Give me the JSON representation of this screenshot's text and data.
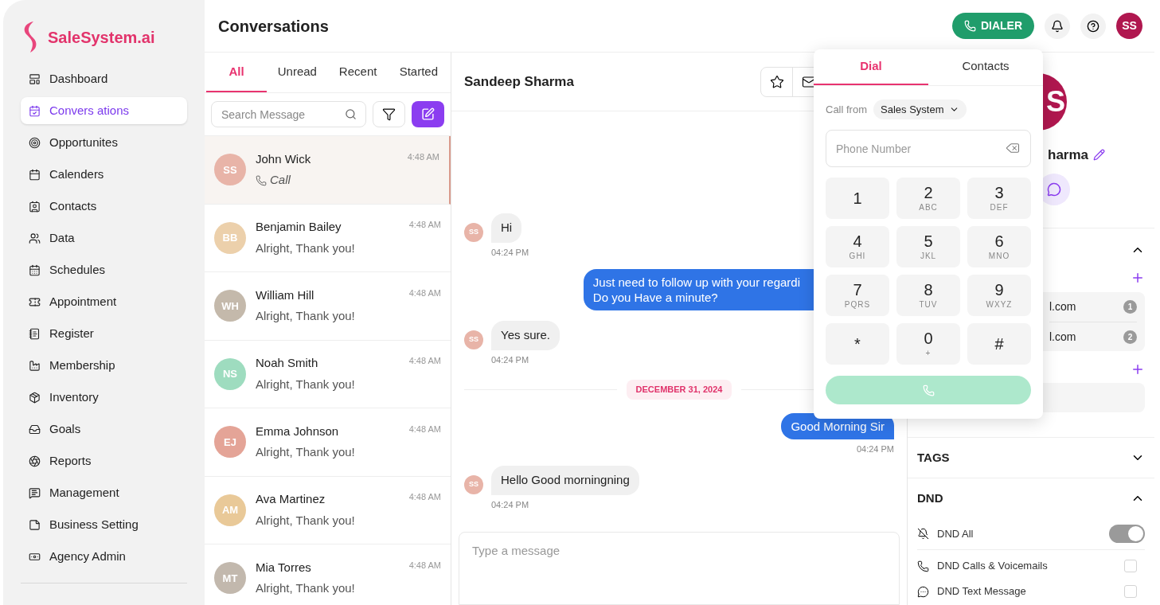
{
  "sidebar": {
    "logo": "SaleSystem.ai",
    "items": [
      {
        "label": "Dashboard",
        "selected": false
      },
      {
        "label": "Convers ations",
        "selected": true
      },
      {
        "label": "Opportunites",
        "selected": false
      },
      {
        "label": "Calenders",
        "selected": false
      },
      {
        "label": "Contacts",
        "selected": false
      },
      {
        "label": "Data",
        "selected": false
      },
      {
        "label": "Schedules",
        "selected": false
      },
      {
        "label": "Appointment",
        "selected": false
      },
      {
        "label": "Register",
        "selected": false
      },
      {
        "label": "Membership",
        "selected": false
      },
      {
        "label": "Inventory",
        "selected": false
      },
      {
        "label": "Goals",
        "selected": false
      },
      {
        "label": "Reports",
        "selected": false
      },
      {
        "label": "Management",
        "selected": false
      },
      {
        "label": "Business Setting",
        "selected": false
      },
      {
        "label": "Agency Admin",
        "selected": false
      }
    ]
  },
  "header": {
    "title": "Conversations",
    "dialer_button": "DIALER",
    "user_initials": "SS"
  },
  "conversation_list": {
    "tabs": [
      {
        "label": "All",
        "selected": true
      },
      {
        "label": "Unread",
        "selected": false
      },
      {
        "label": "Recent",
        "selected": false
      },
      {
        "label": "Started",
        "selected": false
      }
    ],
    "search": {
      "placeholder": "Search Message"
    },
    "items": [
      {
        "initials": "SS",
        "color": "#e8b4a8",
        "name": "John Wick",
        "time": "4:48 AM",
        "preview": "Call",
        "kind": "call",
        "selected": true
      },
      {
        "initials": "BB",
        "color": "#ecd0ab",
        "name": "Benjamin Bailey",
        "time": "4:48 AM",
        "preview": "Alright, Thank you!",
        "kind": "text",
        "selected": false
      },
      {
        "initials": "WH",
        "color": "#c4b9ab",
        "name": "William Hill",
        "time": "4:48 AM",
        "preview": "Alright, Thank you!",
        "kind": "text",
        "selected": false
      },
      {
        "initials": "NS",
        "color": "#9edcbf",
        "name": "Noah Smith",
        "time": "4:48 AM",
        "preview": "Alright, Thank you!",
        "kind": "text",
        "selected": false
      },
      {
        "initials": "EJ",
        "color": "#e4a497",
        "name": "Emma Johnson",
        "time": "4:48 AM",
        "preview": "Alright, Thank you!",
        "kind": "text",
        "selected": false
      },
      {
        "initials": "AM",
        "color": "#e9c998",
        "name": "Ava Martinez",
        "time": "4:48 AM",
        "preview": "Alright, Thank you!",
        "kind": "text",
        "selected": false
      },
      {
        "initials": "MT",
        "color": "#c2b8ad",
        "name": "Mia Torres",
        "time": "4:48 AM",
        "preview": "Alright, Thank you!",
        "kind": "text",
        "selected": false
      }
    ]
  },
  "chat": {
    "contact_name": "Sandeep Sharma",
    "messages": [
      {
        "kind": "incoming",
        "initials": "SS",
        "color": "#e8b4a8",
        "text": "Hi",
        "time": "04:24 PM"
      },
      {
        "kind": "outgoing",
        "text": "Just need to follow up with your regardi\nDo you Have a minute?"
      },
      {
        "kind": "incoming",
        "initials": "SS",
        "color": "#e8b4a8",
        "text": "Yes sure.",
        "time": "04:24 PM"
      },
      {
        "kind": "date",
        "text": "DECEMBER 31, 2024"
      },
      {
        "kind": "outgoing",
        "text": "Good Morning Sir",
        "time": "04:24 PM"
      },
      {
        "kind": "incoming",
        "initials": "SS",
        "color": "#e8b4a8",
        "text": "Hello Good morningning",
        "time": "04:24 PM"
      }
    ],
    "composer": {
      "placeholder": "Type a message"
    }
  },
  "dialer": {
    "tabs": [
      {
        "label": "Dial",
        "selected": true
      },
      {
        "label": "Contacts",
        "selected": false
      }
    ],
    "call_from_label": "Call from",
    "call_from_value": "Sales System",
    "phone": {
      "placeholder": "Phone Number"
    },
    "keys": [
      {
        "digit": "1"
      },
      {
        "digit": "2",
        "letters": "ABC"
      },
      {
        "digit": "3",
        "letters": "DEF"
      },
      {
        "digit": "4",
        "letters": "GHI"
      },
      {
        "digit": "5",
        "letters": "JKL"
      },
      {
        "digit": "6",
        "letters": "MNO"
      },
      {
        "digit": "7",
        "letters": "PQRS"
      },
      {
        "digit": "8",
        "letters": "TUV"
      },
      {
        "digit": "9",
        "letters": "WXYZ"
      },
      {
        "digit": "*"
      },
      {
        "digit": "0",
        "letters": "+"
      },
      {
        "digit": "#"
      }
    ]
  },
  "contact_panel": {
    "avatar_letter": "S",
    "name": "harma",
    "contact_section": {
      "expanded": true
    },
    "emails": [
      {
        "text": "l.com",
        "badge": "1"
      },
      {
        "text": "l.com",
        "badge": "2"
      }
    ],
    "sections": [
      {
        "title": "TAGS",
        "expanded": false
      },
      {
        "title": "DND",
        "expanded": true
      }
    ],
    "dnd": [
      {
        "kind": "toggle",
        "label": "DND All",
        "on": true
      },
      {
        "kind": "checkbox",
        "label": "DND Calls & Voicemails",
        "checked": false
      },
      {
        "kind": "checkbox",
        "label": "DND Text Message",
        "checked": false
      }
    ]
  }
}
